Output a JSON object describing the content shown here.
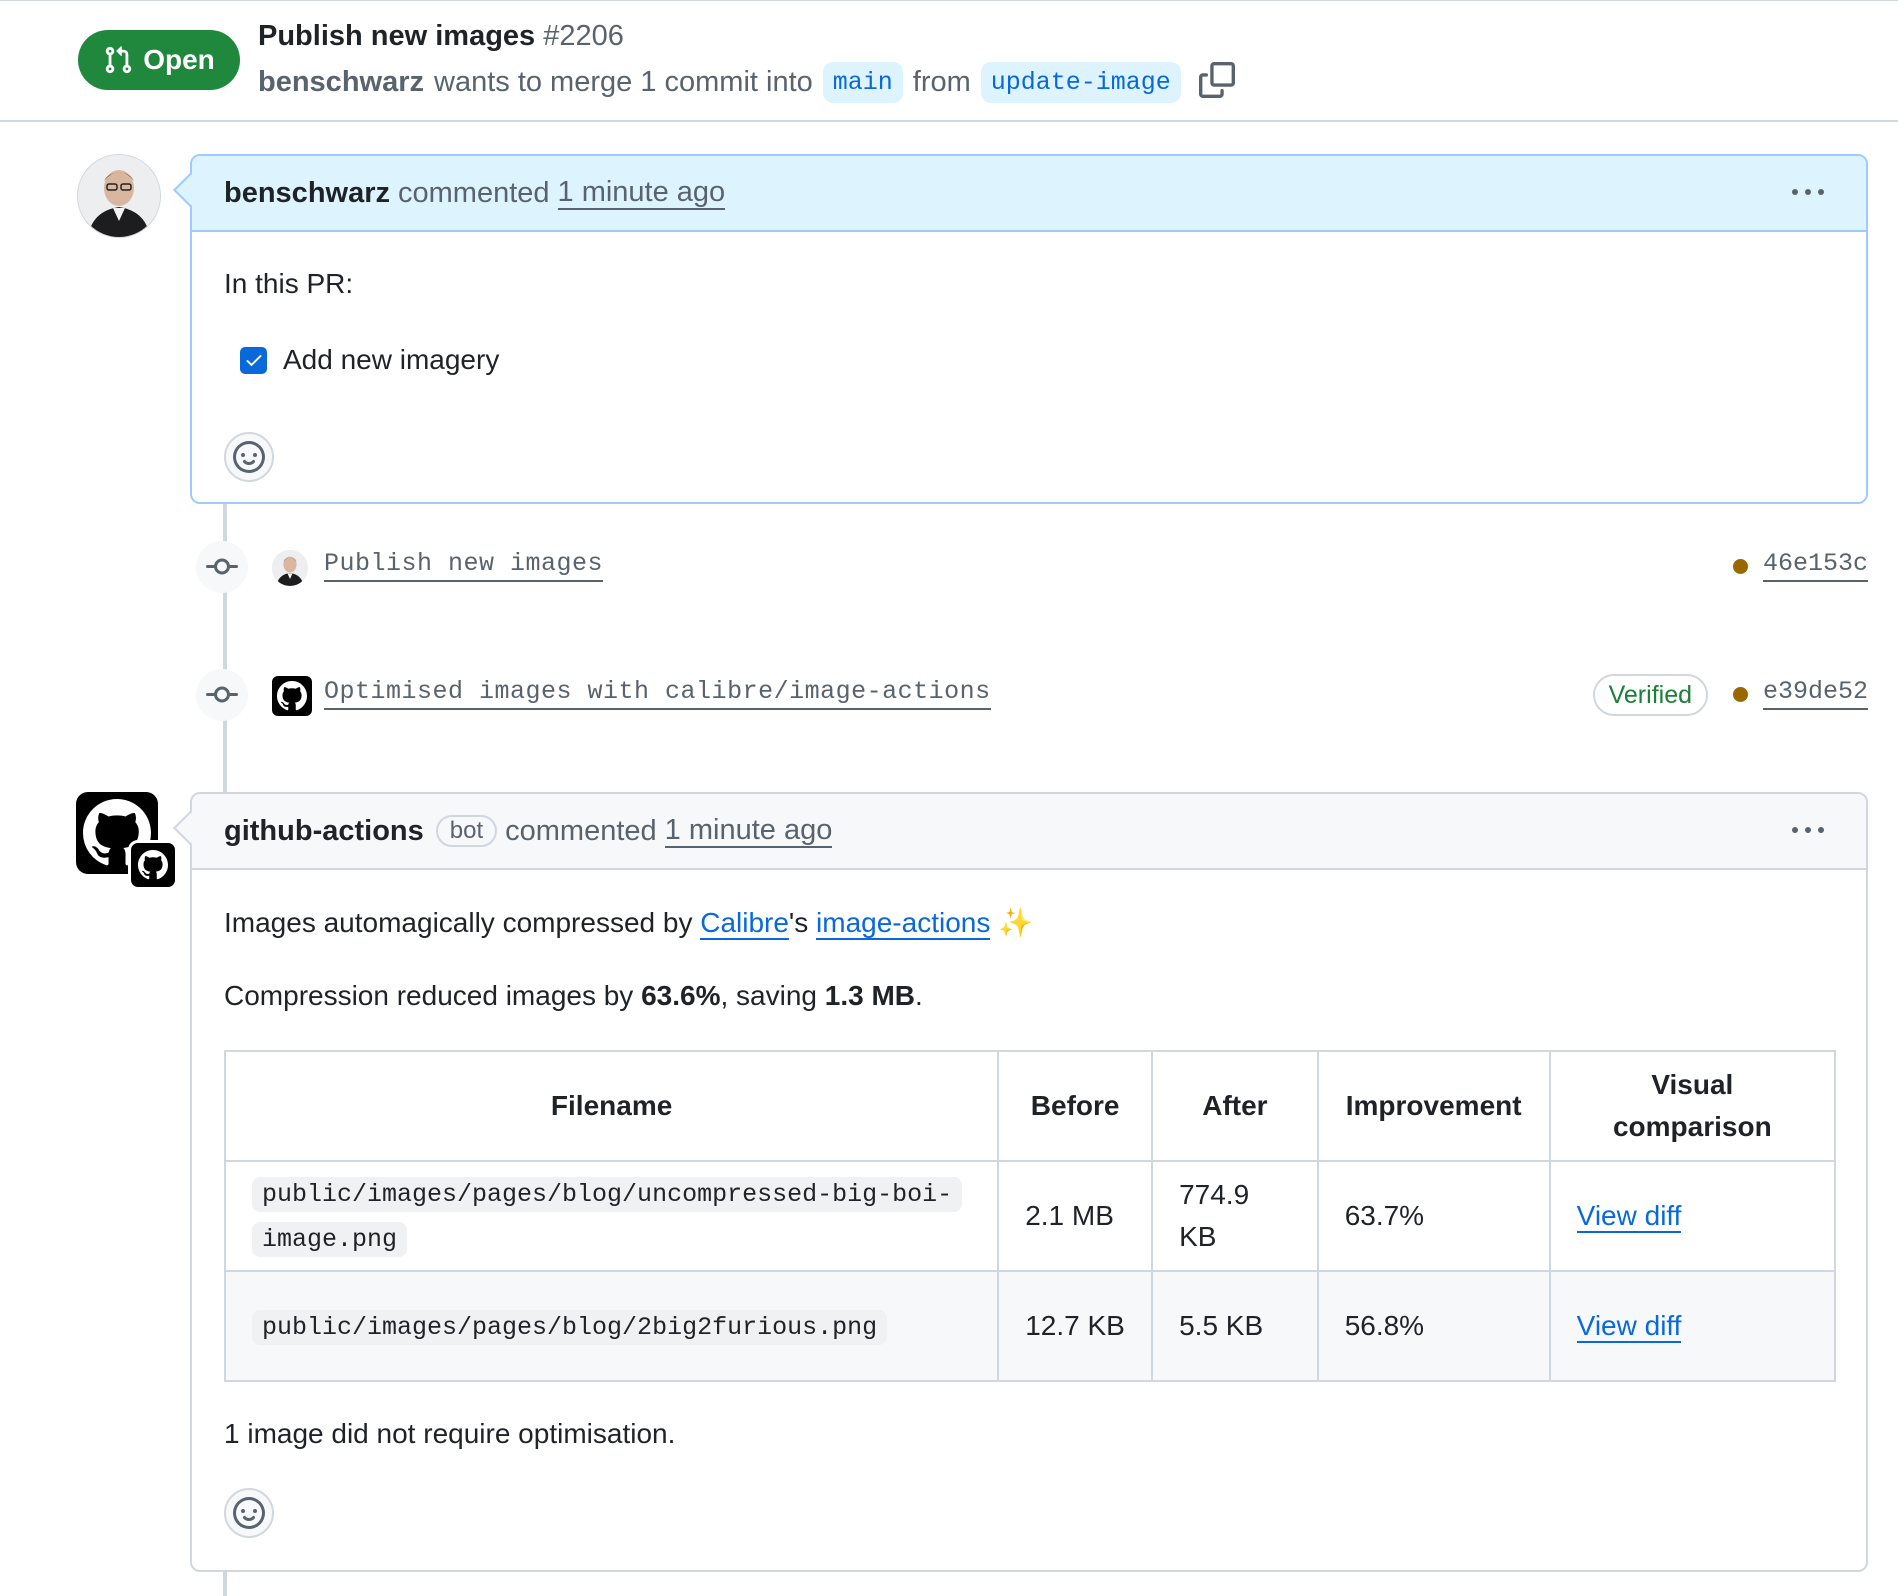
{
  "header": {
    "status_label": "Open",
    "title": "Publish new images",
    "number": "#2206",
    "author": "benschwarz",
    "merge_text": "wants to merge 1 commit into",
    "base_branch": "main",
    "from_text": "from",
    "head_branch": "update-image"
  },
  "comment1": {
    "author": "benschwarz",
    "action": "commented",
    "time": "1 minute ago",
    "intro": "In this PR:",
    "task_label": "Add new imagery",
    "task_checked": true
  },
  "commits": [
    {
      "message": "Publish new images",
      "sha": "46e153c",
      "verified": false
    },
    {
      "message": "Optimised images with calibre/image-actions",
      "sha": "e39de52",
      "verified": true,
      "verified_label": "Verified"
    }
  ],
  "comment2": {
    "author": "github-actions",
    "bot_label": "bot",
    "action": "commented",
    "time": "1 minute ago",
    "line1_prefix": "Images automagically compressed by ",
    "line1_link1": "Calibre",
    "line1_mid": "'s ",
    "line1_link2": "image-actions",
    "line1_emoji": "✨",
    "line2_prefix": "Compression reduced images by ",
    "line2_pct": "63.6%",
    "line2_mid": ", saving ",
    "line2_size": "1.3 MB",
    "line2_end": ".",
    "table": {
      "headers": [
        "Filename",
        "Before",
        "After",
        "Improvement",
        "Visual\ncomparison"
      ],
      "rows": [
        {
          "filename": "public/images/pages/blog/uncompressed-big-boi-image.png",
          "before": "2.1 MB",
          "after": "774.9 KB",
          "improvement": "63.7%",
          "link": "View diff"
        },
        {
          "filename": "public/images/pages/blog/2big2furious.png",
          "before": "12.7 KB",
          "after": "5.5 KB",
          "improvement": "56.8%",
          "link": "View diff"
        }
      ]
    },
    "footer": "1 image did not require optimisation."
  },
  "colors": {
    "open_green": "#1f883d",
    "link_blue": "#0969da",
    "branch_bg": "#ddf4ff",
    "verified_green": "#1a7f37",
    "commit_dot": "#9a6700"
  },
  "icons": [
    "pull-request-icon",
    "copy-icon",
    "kebab-icon",
    "smiley-icon",
    "commit-icon",
    "github-mark-icon",
    "checkbox-icon",
    "sparkles-icon"
  ]
}
